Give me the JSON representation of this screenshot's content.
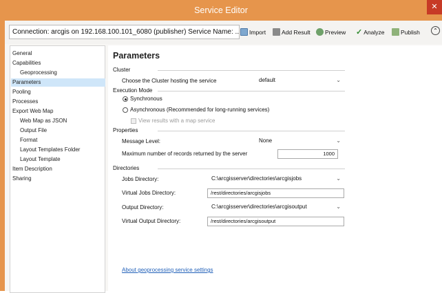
{
  "window": {
    "title": "Service Editor",
    "close_glyph": "✕"
  },
  "toolbar": {
    "connection_text": "Connection: arcgis on 192.168.100.101_6080 (publisher)  Service Name: ...",
    "import_label": "Import",
    "add_result_label": "Add Result",
    "preview_label": "Preview",
    "analyze_label": "Analyze",
    "publish_label": "Publish",
    "collapse_glyph": "⌃"
  },
  "nav": {
    "items": [
      {
        "label": "General"
      },
      {
        "label": "Capabilities"
      },
      {
        "label": "Geoprocessing"
      },
      {
        "label": "Parameters"
      },
      {
        "label": "Pooling"
      },
      {
        "label": "Processes"
      },
      {
        "label": "Export Web Map"
      },
      {
        "label": "Web Map as JSON"
      },
      {
        "label": "Output File"
      },
      {
        "label": "Format"
      },
      {
        "label": "Layout Templates Folder"
      },
      {
        "label": "Layout Template"
      },
      {
        "label": "Item Description"
      },
      {
        "label": "Sharing"
      }
    ],
    "selected": "Parameters"
  },
  "main": {
    "heading": "Parameters",
    "cluster": {
      "section": "Cluster",
      "label": "Choose the Cluster hosting the service",
      "value": "default"
    },
    "execution": {
      "section": "Execution Mode",
      "synchronous": "Synchronous",
      "asynchronous": "Asynchronous (Recommended for long-running services)",
      "view_results": "View results with a map service",
      "selected": "Synchronous"
    },
    "properties": {
      "section": "Properties",
      "message_label": "Message Level:",
      "message_value": "None",
      "max_records_label": "Maximum number of records returned by the server",
      "max_records_value": "1000"
    },
    "directories": {
      "section": "Directories",
      "jobs_label": "Jobs Directory:",
      "jobs_value": "C:\\arcgisserver\\directories\\arcgisjobs",
      "virtual_jobs_label": "Virtual Jobs Directory:",
      "virtual_jobs_value": "/rest/directories/arcgisjobs",
      "output_label": "Output Directory:",
      "output_value": "C:\\arcgisserver\\directories\\arcgisoutput",
      "virtual_output_label": "Virtual Output Directory:",
      "virtual_output_value": "/rest/directories/arcgisoutput"
    },
    "about_link": "About geoprocessing service settings"
  },
  "colors": {
    "frame": "#e6954c",
    "close": "#c73a26",
    "selection": "#cfe6f9",
    "link": "#1f5fb8"
  },
  "icons": [
    "import-icon",
    "add-result-icon",
    "preview-icon",
    "analyze-check-icon",
    "publish-icon",
    "collapse-chevron-icon",
    "close-icon",
    "chevron-down-icon"
  ]
}
